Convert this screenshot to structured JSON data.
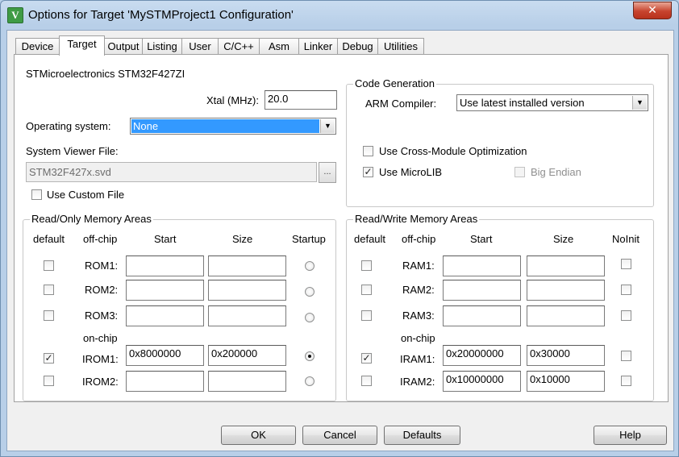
{
  "window": {
    "title": "Options for Target 'MySTMProject1 Configuration'",
    "app_icon_glyph": "V",
    "close_glyph": "✕"
  },
  "tabs": [
    "Device",
    "Target",
    "Output",
    "Listing",
    "User",
    "C/C++",
    "Asm",
    "Linker",
    "Debug",
    "Utilities"
  ],
  "active_tab": "Target",
  "device_name": "STMicroelectronics STM32F427ZI",
  "xtal": {
    "label": "Xtal (MHz):",
    "value": "20.0"
  },
  "os": {
    "label": "Operating system:",
    "value": "None"
  },
  "svd": {
    "label": "System Viewer File:",
    "value": "STM32F427x.svd",
    "browse": "..."
  },
  "custom_file": {
    "label": "Use Custom File",
    "checked": false
  },
  "code_gen": {
    "title": "Code Generation",
    "compiler_label": "ARM Compiler:",
    "compiler_value": "Use latest installed version",
    "cross_module": {
      "label": "Use Cross-Module Optimization",
      "checked": false
    },
    "microlib": {
      "label": "Use MicroLIB",
      "checked": true
    },
    "big_endian": {
      "label": "Big Endian",
      "checked": false,
      "enabled": false
    }
  },
  "rom_areas": {
    "title": "Read/Only Memory Areas",
    "headers": {
      "default": "default",
      "offchip": "off-chip",
      "start": "Start",
      "size": "Size",
      "startup": "Startup"
    },
    "onchip_label": "on-chip",
    "rows": [
      {
        "name": "ROM1:",
        "default": false,
        "start": "",
        "size": "",
        "startup": false
      },
      {
        "name": "ROM2:",
        "default": false,
        "start": "",
        "size": "",
        "startup": false
      },
      {
        "name": "ROM3:",
        "default": false,
        "start": "",
        "size": "",
        "startup": false
      },
      {
        "name": "IROM1:",
        "default": true,
        "start": "0x8000000",
        "size": "0x200000",
        "startup": true
      },
      {
        "name": "IROM2:",
        "default": false,
        "start": "",
        "size": "",
        "startup": false
      }
    ]
  },
  "ram_areas": {
    "title": "Read/Write Memory Areas",
    "headers": {
      "default": "default",
      "offchip": "off-chip",
      "start": "Start",
      "size": "Size",
      "noinit": "NoInit"
    },
    "onchip_label": "on-chip",
    "rows": [
      {
        "name": "RAM1:",
        "default": false,
        "start": "",
        "size": "",
        "noinit": false
      },
      {
        "name": "RAM2:",
        "default": false,
        "start": "",
        "size": "",
        "noinit": false
      },
      {
        "name": "RAM3:",
        "default": false,
        "start": "",
        "size": "",
        "noinit": false
      },
      {
        "name": "IRAM1:",
        "default": true,
        "start": "0x20000000",
        "size": "0x30000",
        "noinit": false
      },
      {
        "name": "IRAM2:",
        "default": false,
        "start": "0x10000000",
        "size": "0x10000",
        "noinit": false
      }
    ]
  },
  "buttons": {
    "ok": "OK",
    "cancel": "Cancel",
    "defaults": "Defaults",
    "help": "Help"
  },
  "check_glyph": "✓",
  "colors": {
    "selection": "#3399ff",
    "close_button": "#c7432e",
    "title_bar": "#b9d1ea"
  }
}
